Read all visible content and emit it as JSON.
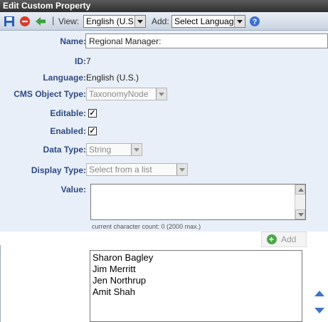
{
  "window": {
    "title": "Edit Custom Property"
  },
  "toolbar": {
    "separator": "|",
    "view_label": "View:",
    "view_value": "English (U.S.)",
    "add_label": "Add:",
    "add_value": "Select Language"
  },
  "form": {
    "name_label": "Name:",
    "name_value": "Regional Manager:",
    "id_label": "ID:",
    "id_value": "7",
    "language_label": "Language:",
    "language_value": "English (U.S.)",
    "cms_type_label": "CMS Object Type:",
    "cms_type_value": "TaxonomyNode",
    "editable_label": "Editable:",
    "editable_checked": true,
    "enabled_label": "Enabled:",
    "enabled_checked": true,
    "data_type_label": "Data Type:",
    "data_type_value": "String",
    "display_type_label": "Display Type:",
    "display_type_value": "Select from a list",
    "value_label": "Value:",
    "value_text": "",
    "counter_text": "current character count: 0 (2000 max.)",
    "add_button_label": "Add",
    "check_mark": "✓"
  },
  "list": {
    "items": [
      "Sharon Bagley",
      "Jim Merritt",
      "Jen Northrup",
      "Amit Shah"
    ]
  },
  "colors": {
    "title_bar": "#3a3a3a",
    "panel_bg": "#e9eff8",
    "label": "#2e4a82",
    "move_arrows": "#3a73c8"
  }
}
